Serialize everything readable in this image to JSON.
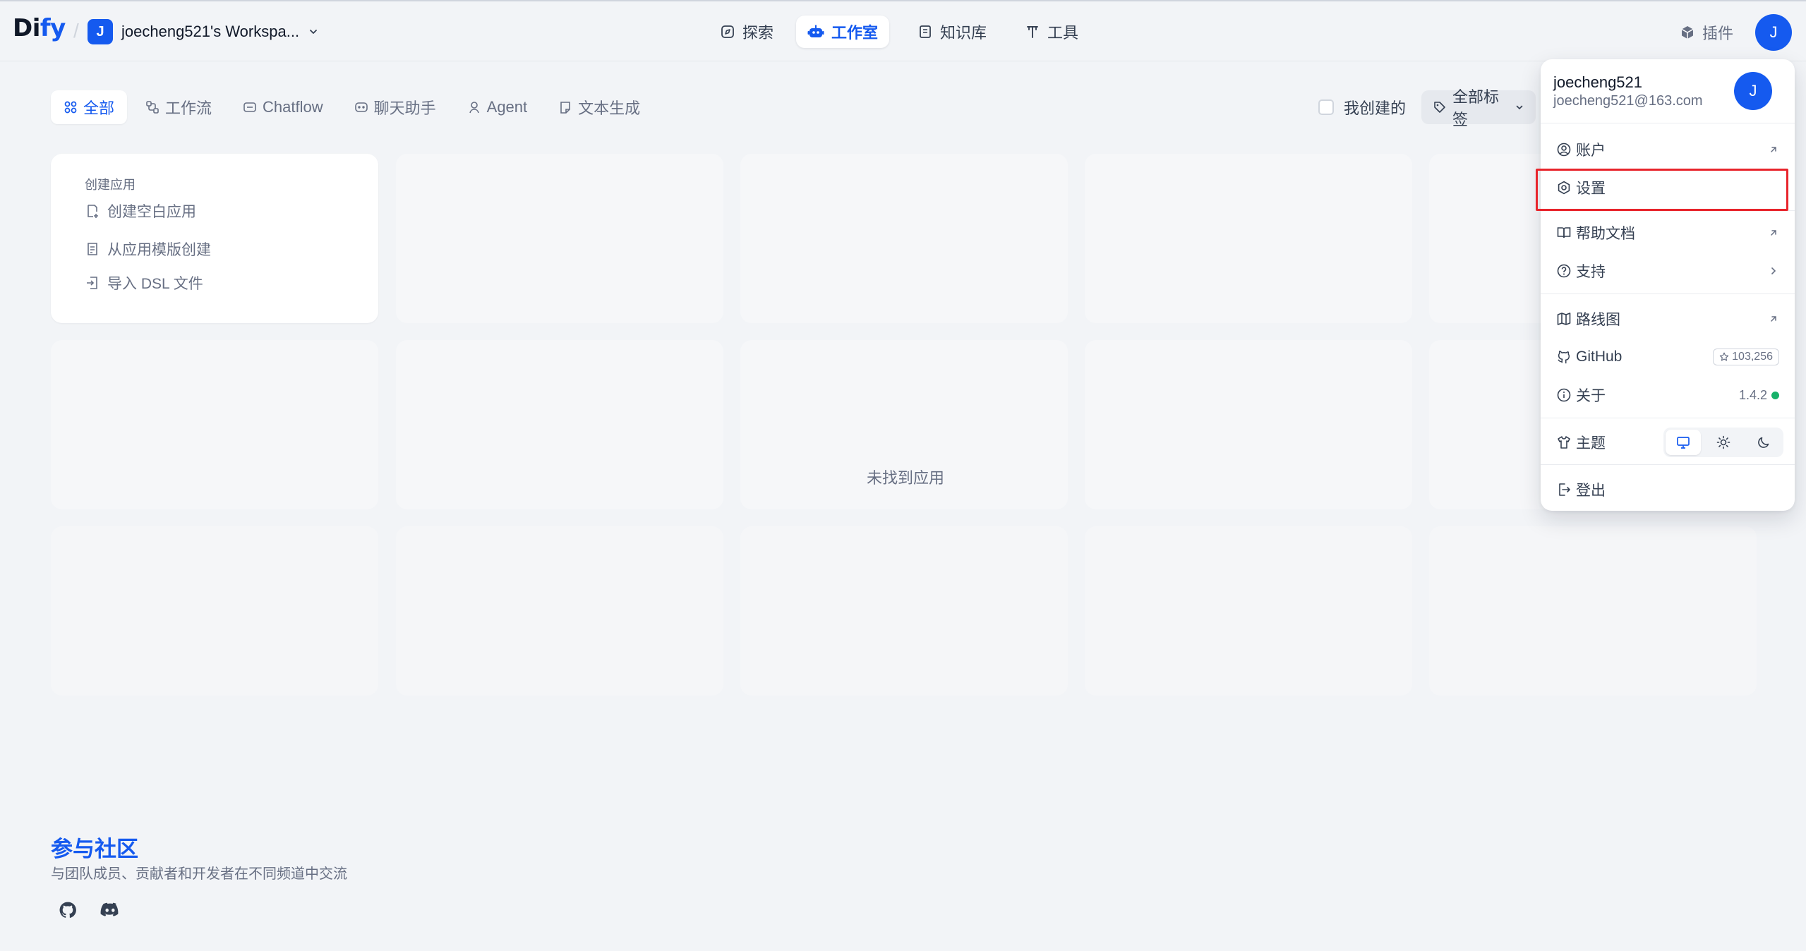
{
  "header": {
    "logo_main": "Di",
    "logo_accent": "fy",
    "workspace_initial": "J",
    "workspace_name": "joecheng521's Workspa...",
    "nav": {
      "explore": "探索",
      "studio": "工作室",
      "knowledge": "知识库",
      "tools": "工具"
    },
    "plugins": "插件",
    "avatar_initial": "J"
  },
  "filters": {
    "tabs": [
      "全部",
      "工作流",
      "Chatflow",
      "聊天助手",
      "Agent",
      "文本生成"
    ],
    "active_tab": "全部",
    "mine_label": "我创建的",
    "mine_checked": false,
    "tags_label": "全部标签"
  },
  "create_card": {
    "title": "创建应用",
    "items": [
      "创建空白应用",
      "从应用模版创建",
      "导入 DSL 文件"
    ]
  },
  "empty_text": "未找到应用",
  "community": {
    "title": "参与社区",
    "subtitle": "与团队成员、贡献者和开发者在不同频道中交流"
  },
  "user_menu": {
    "name": "joecheng521",
    "email": "joecheng521@163.com",
    "avatar_initial": "J",
    "items": {
      "account": "账户",
      "settings": "设置",
      "help_docs": "帮助文档",
      "support": "支持",
      "roadmap": "路线图",
      "github": "GitHub",
      "github_stars": "103,256",
      "about": "关于",
      "version": "1.4.2",
      "theme": "主题",
      "theme_selected": "system",
      "logout": "登出"
    }
  },
  "colors": {
    "accent": "#155aef",
    "highlight": "#e8242b",
    "status_ok": "#17b26a"
  }
}
